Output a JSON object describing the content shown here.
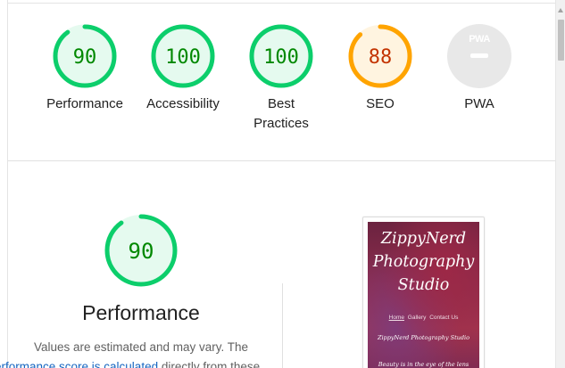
{
  "summary": {
    "gauges": [
      {
        "label": "Performance",
        "score": "90",
        "value": 90,
        "status": "pass"
      },
      {
        "label": "Accessibility",
        "score": "100",
        "value": 100,
        "status": "pass"
      },
      {
        "label": "Best Practices",
        "score": "100",
        "value": 100,
        "status": "pass"
      },
      {
        "label": "SEO",
        "score": "88",
        "value": 88,
        "status": "average"
      },
      {
        "label": "PWA",
        "score": "",
        "value": null,
        "status": "na"
      }
    ]
  },
  "colors": {
    "pass": "#0cce6b",
    "pass_bg": "#e5faef",
    "pass_text": "#008800",
    "average": "#ffa400",
    "average_bg": "#fff4e0",
    "average_text": "#c33300",
    "na": "#e8e8e8"
  },
  "performance": {
    "score": "90",
    "value": 90,
    "title": "Performance",
    "desc_line1": "Values are estimated and may vary. The",
    "desc_link": "erformance score is calculated",
    "desc_after": " directly from these"
  },
  "pwa_badge": "PWA",
  "screenshot": {
    "title_lines": [
      "ZippyNerd",
      "Photography",
      "Studio"
    ],
    "nav": [
      "Home",
      "Gallery",
      "Contact Us"
    ],
    "studio_name": "ZippyNerd Photography Studio",
    "tagline": "Beauty is in the eye of the lens holder!"
  }
}
